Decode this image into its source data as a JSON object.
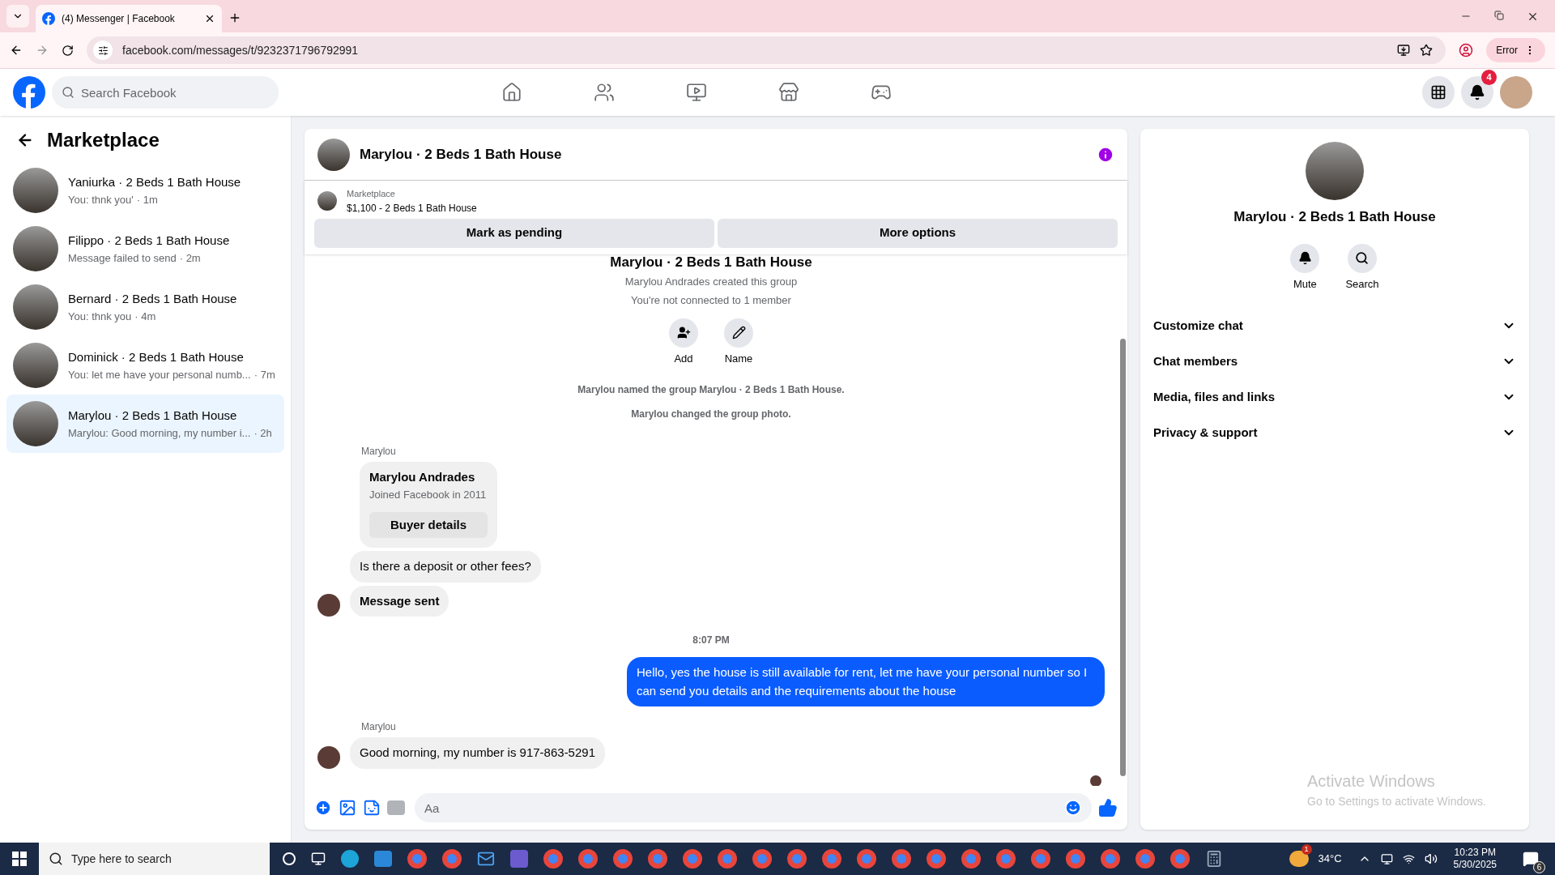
{
  "browser": {
    "tab_title": "(4) Messenger | Facebook",
    "url": "facebook.com/messages/t/9232371796792991",
    "profile_button": "Error"
  },
  "header": {
    "search": {
      "placeholder": "Search Facebook"
    },
    "nav": [
      {
        "kind": "home"
      },
      {
        "kind": "friends"
      },
      {
        "kind": "watch"
      },
      {
        "kind": "marketplace"
      },
      {
        "kind": "gaming"
      }
    ],
    "notification_badge": "4"
  },
  "sidebar": {
    "title": "Marketplace",
    "conversations": [
      {
        "name": "Yaniurka · 2 Beds 1 Bath House",
        "preview": "You: thnk you'",
        "time": "· 1m",
        "selected": false
      },
      {
        "name": "Filippo · 2 Beds 1 Bath House",
        "preview": "Message failed to send",
        "time": "· 2m",
        "selected": false
      },
      {
        "name": "Bernard · 2 Beds 1 Bath House",
        "preview": "You: thnk you",
        "time": "· 4m",
        "selected": false
      },
      {
        "name": "Dominick · 2 Beds 1 Bath House",
        "preview": "You: let me have your personal numb...",
        "time": "· 7m",
        "selected": false
      },
      {
        "name": "Marylou · 2 Beds 1 Bath House",
        "preview": "Marylou: Good morning, my number i...",
        "time": "· 2h",
        "selected": true
      }
    ]
  },
  "chat": {
    "title": "Marylou · 2 Beds 1 Bath House",
    "listing": {
      "label": "Marketplace",
      "title": "$1,100 - 2 Beds 1 Bath House"
    },
    "actions": [
      "Mark as pending",
      "More options"
    ],
    "intro": {
      "title": "Marylou · 2 Beds 1 Bath House",
      "lines": [
        "Marylou Andrades created this group",
        "You're not connected to 1 member"
      ],
      "buttons": [
        {
          "kind": "add",
          "label": "Add"
        },
        {
          "kind": "name",
          "label": "Name"
        }
      ]
    },
    "timeline": [
      {
        "kind": "event",
        "text": "Marylou named the group Marylou · 2 Beds 1 Bath House."
      },
      {
        "kind": "event",
        "text": "Marylou changed the group photo."
      },
      {
        "kind": "sender",
        "text": "Marylou"
      },
      {
        "kind": "card",
        "title": "Marylou Andrades",
        "subtitle": "Joined Facebook in 2011",
        "button": "Buyer details"
      },
      {
        "kind": "incoming",
        "text": "Is there a deposit or other fees?",
        "avatar": false,
        "bold": false
      },
      {
        "kind": "incoming",
        "text": "Message sent",
        "avatar": true,
        "bold": true
      },
      {
        "kind": "time",
        "text": "8:07 PM"
      },
      {
        "kind": "outgoing",
        "text": "Hello, yes the house is still available for rent, let me have your personal number so I can send you details and the requirements about the house"
      },
      {
        "kind": "sender",
        "text": "Marylou"
      },
      {
        "kind": "incoming",
        "text": "Good morning, my number is 917-863-5291",
        "avatar": true,
        "bold": false
      }
    ],
    "composer": {
      "placeholder": "Aa"
    }
  },
  "details": {
    "name": "Marylou · 2 Beds 1 Bath House",
    "actions": [
      {
        "kind": "mute",
        "label": "Mute"
      },
      {
        "kind": "search",
        "label": "Search"
      }
    ],
    "sections": [
      {
        "label": "Customize chat",
        "expanded": false
      },
      {
        "label": "Chat members",
        "expanded": false
      },
      {
        "label": "Media, files and links",
        "expanded": false
      },
      {
        "label": "Privacy & support",
        "expanded": false
      }
    ]
  },
  "activation_notice": {
    "title": "Activate Windows",
    "subtitle": "Go to Settings to activate Windows."
  },
  "taskbar": {
    "search_placeholder": "Type here to search",
    "weather_badge": "1",
    "temperature": "34°C",
    "time": "10:23 PM",
    "date": "5/30/2025",
    "notification_count": "6"
  }
}
